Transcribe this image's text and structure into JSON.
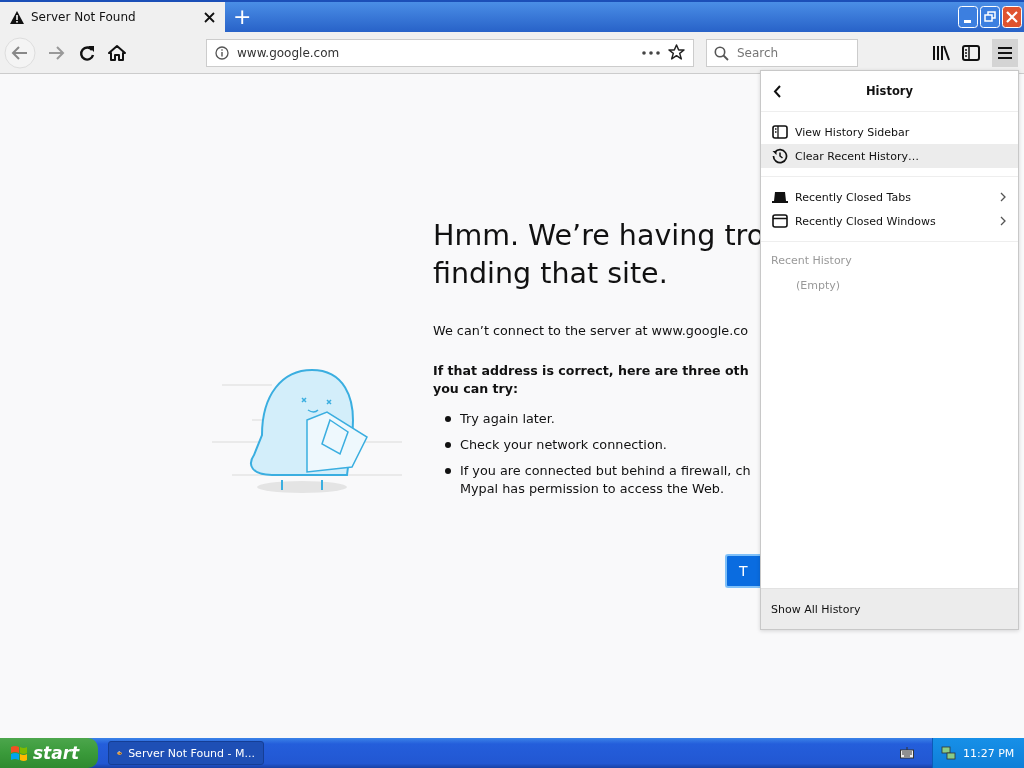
{
  "tab": {
    "title": "Server Not Found",
    "new_tab": "+"
  },
  "toolbar": {
    "url": "www.google.com",
    "search_placeholder": "Search",
    "menu_open": true
  },
  "page": {
    "heading_lines": [
      "Hmm. We’re having tro",
      "finding that site."
    ],
    "message": "We can’t connect to the server at www.google.co",
    "advice_lines": [
      "If that address is correct, here are three oth",
      "you can try:"
    ],
    "suggestions": [
      {
        "lines": [
          "Try again later."
        ]
      },
      {
        "lines": [
          "Check your network connection."
        ]
      },
      {
        "lines": [
          "If you are connected but behind a firewall, ch",
          "Mypal has permission to access the Web."
        ]
      }
    ],
    "button": "T"
  },
  "panel": {
    "title": "History",
    "groups": [
      [
        {
          "label": "View History Sidebar",
          "selected": false,
          "submenu": false
        },
        {
          "label": "Clear Recent History…",
          "selected": true,
          "submenu": false
        }
      ],
      [
        {
          "label": "Recently Closed Tabs",
          "selected": false,
          "submenu": true
        },
        {
          "label": "Recently Closed Windows",
          "selected": false,
          "submenu": true
        }
      ]
    ],
    "section": "Recent History",
    "empty": "(Empty)",
    "footer": "Show All History"
  },
  "taskbar": {
    "start": "start",
    "task": "Server Not Found - M...",
    "time": "11:27 PM"
  }
}
